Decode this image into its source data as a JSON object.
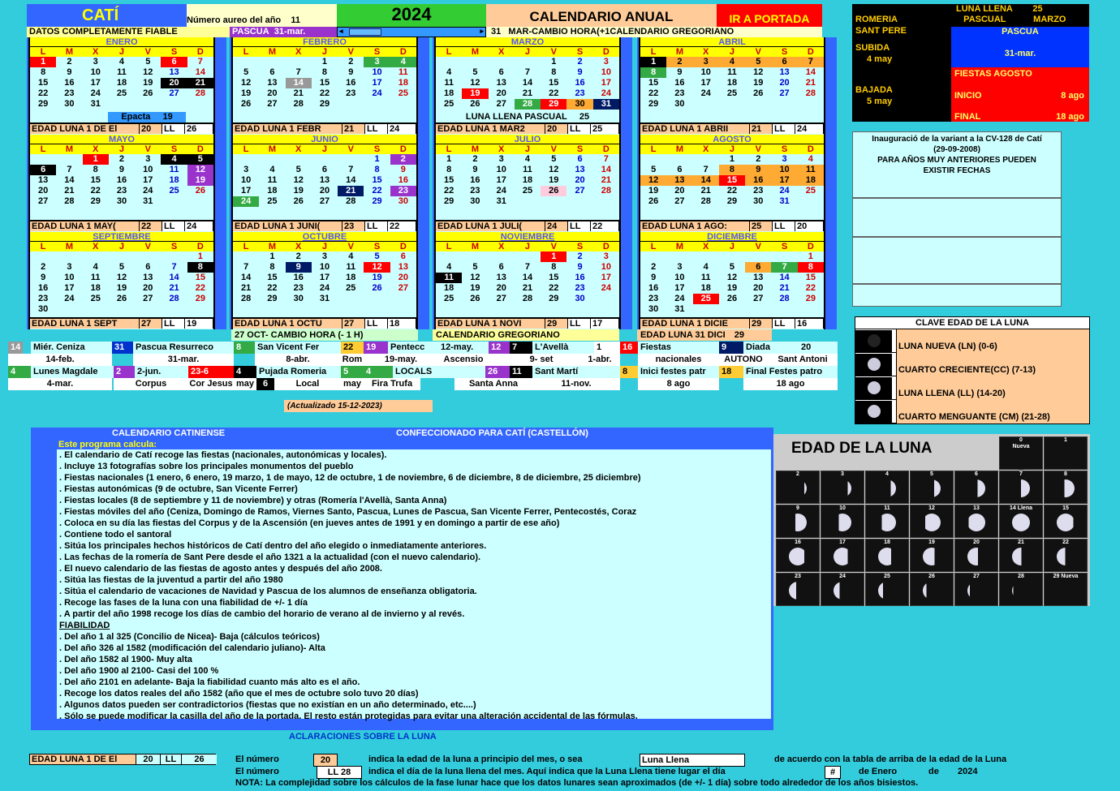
{
  "header": {
    "town": "CATÍ",
    "golden_label": "Número aureo del año",
    "golden_value": "11",
    "year": "2024",
    "title": "CALENDARIO ANUAL",
    "link": "IR A PORTADA",
    "reliable": "DATOS COMPLETAMENTE FIABLE",
    "easter_label": "PASCUA",
    "easter_date": "31-mar.",
    "dst_day": "31",
    "dst_text": "MAR-CAMBIO HORA(+1",
    "greg": "CALENDARIO GREGORIANO"
  },
  "weekdays": [
    "L",
    "M",
    "X",
    "J",
    "V",
    "S",
    "D"
  ],
  "months": [
    {
      "name": "ENERO",
      "offset": 0,
      "days": 31,
      "foot": "EDAD LUNA 1 DE El",
      "age": "20",
      "ll": "LL",
      "lld": "26",
      "extra": "Epacta",
      "extraval": "19",
      "hl": {
        "1": "hl-red",
        "6": "hl-red",
        "20": "hl-black",
        "21": "hl-black"
      }
    },
    {
      "name": "FEBRERO",
      "offset": 3,
      "days": 29,
      "foot": "EDAD LUNA 1 FEBR",
      "age": "21",
      "ll": "LL",
      "lld": "24",
      "hl": {
        "3": "hl-green",
        "4": "hl-green",
        "14": "hl-gray"
      }
    },
    {
      "name": "MARZO",
      "offset": 4,
      "days": 31,
      "foot": "EDAD LUNA 1 MAR2",
      "age": "20",
      "ll": "LL",
      "lld": "25",
      "extra": "LUNA LLENA PASCUAL",
      "extraval": "25",
      "hl": {
        "19": "hl-red",
        "28": "hl-green",
        "29": "hl-red",
        "30": "hl-orange",
        "31": "hl-navy"
      }
    },
    {
      "name": "ABRIL",
      "offset": 0,
      "days": 30,
      "foot": "EDAD LUNA 1 ABRII",
      "age": "21",
      "ll": "LL",
      "lld": "24",
      "hl": {
        "1": "hl-black",
        "2": "hl-orange",
        "3": "hl-orange",
        "4": "hl-orange",
        "5": "hl-orange",
        "6": "hl-orange",
        "7": "hl-orange",
        "8": "hl-green"
      }
    },
    {
      "name": "MAYO",
      "offset": 2,
      "days": 31,
      "foot": "EDAD LUNA 1 MAY(",
      "age": "22",
      "ll": "LL",
      "lld": "24",
      "hl": {
        "1": "hl-red",
        "4": "hl-black",
        "5": "hl-black",
        "6": "hl-black",
        "12": "hl-purple",
        "19": "hl-purple"
      }
    },
    {
      "name": "JUNIO",
      "offset": 5,
      "days": 30,
      "foot": "EDAD LUNA 1 JUNI(",
      "age": "23",
      "ll": "LL",
      "lld": "22",
      "hl": {
        "2": "hl-purple",
        "21": "hl-navy",
        "23": "hl-purple",
        "24": "hl-green"
      }
    },
    {
      "name": "JULIO",
      "offset": 0,
      "days": 31,
      "foot": "EDAD LUNA 1 JULI(",
      "age": "24",
      "ll": "LL",
      "lld": "22",
      "hl": {
        "26": "hl-pink"
      }
    },
    {
      "name": "AGOSTO",
      "offset": 3,
      "days": 31,
      "foot": "EDAD LUNA 1 AGO:",
      "age": "25",
      "ll": "LL",
      "lld": "20",
      "hl": {
        "8": "hl-orange",
        "9": "hl-orange",
        "10": "hl-orange",
        "11": "hl-orange",
        "12": "hl-orange",
        "13": "hl-orange",
        "14": "hl-orange",
        "15": "hl-red",
        "16": "hl-orange",
        "17": "hl-orange",
        "18": "hl-orange"
      }
    },
    {
      "name": "SEPTIEMBRE",
      "offset": 6,
      "days": 30,
      "foot": "EDAD LUNA 1 SEPT",
      "age": "27",
      "ll": "LL",
      "lld": "19",
      "hl": {
        "8": "hl-black"
      }
    },
    {
      "name": "OCTUBRE",
      "offset": 1,
      "days": 31,
      "foot": "EDAD LUNA 1 OCTU",
      "age": "27",
      "ll": "LL",
      "lld": "18",
      "extra": "27  OCT- CAMBIO HORA (- 1 H)",
      "hl": {
        "9": "hl-navy",
        "12": "hl-red"
      }
    },
    {
      "name": "NOVIEMBRE",
      "offset": 4,
      "days": 30,
      "foot": "EDAD LUNA 1 NOVI",
      "age": "29",
      "ll": "LL",
      "lld": "17",
      "extra": "CALENDARIO GREGORIANO",
      "hl": {
        "1": "hl-red",
        "11": "hl-black"
      }
    },
    {
      "name": "DICIEMBRE",
      "offset": 6,
      "days": 31,
      "foot": "EDAD LUNA 1 DICIE",
      "age": "29",
      "ll": "LL",
      "lld": "16",
      "extra": "EDAD LUNA 31 DICI",
      "extraval": "29",
      "hl": {
        "6": "hl-orange",
        "7": "hl-green",
        "8": "hl-red",
        "25": "hl-red"
      }
    }
  ],
  "right": {
    "romeria": "ROMERIA\nSANT PERE",
    "subida": "SUBIDA",
    "subida_val": "4    may",
    "bajada": "BAJADA",
    "bajada_val": "5     may",
    "ll_label": "LUNA LLENA",
    "ll_day": "25",
    "pascual": "PASCUAL",
    "marzo": "MARZO",
    "pascua": "PASCUA",
    "pascua_date": "31-mar.",
    "fiestas": "FIESTAS AGOSTO",
    "inicio": "INICIO",
    "inicio_val": "8  ago",
    "final": "FINAL",
    "final_val": "18  ago",
    "inaug": "Inauguració de la variant a la CV-128 de Catí (29-09-2008)",
    "warn": "PARA AÑOS MUY ANTERIORES PUEDEN EXISTIR FECHAS",
    "clave": "CLAVE EDAD DE LA LUNA",
    "phases": [
      "LUNA NUEVA (LN) (0-6)",
      "CUARTO CRECIENTE(CC) (7-13)",
      "LUNA LLENA (LL) (14-20)",
      "CUARTO MENGUANTE (CM) (21-28)"
    ]
  },
  "legend": [
    [
      "14",
      "Miér. Ceniza",
      "14-feb.",
      "31",
      "Pascua Resurreco",
      "31-mar.",
      "8",
      "San Vicent Fer",
      "8-abr.",
      "Rom",
      "22",
      "19",
      "Pentecc",
      "19-may.",
      "12-may.",
      "12",
      "7",
      "L'Avellà",
      "1",
      "16",
      "Fiestas",
      "nacionales",
      "Ascensio",
      "9- set",
      "1-abr.",
      "9",
      "Diada",
      "20",
      "AUTONO",
      "Sant Antoni"
    ],
    [
      "4",
      "Lunes Magdale",
      "4-mar.",
      "2",
      "2-jun.",
      "Corpus",
      "23-6",
      "Cor Jesus",
      "4",
      "Pujada Romeria",
      "may",
      "6",
      "Local",
      "5",
      "4",
      "Fira Trufa",
      "LOCALS",
      "26",
      "11",
      "Sant Martí",
      "Santa Anna",
      "11-nov.",
      "8",
      "Inici festes patr",
      "8  ago",
      "18",
      "Final Festes patro",
      "18  ago"
    ]
  ],
  "updated": "(Actualizado 15-12-2023)",
  "info": {
    "title": "CALENDARIO CATINENSE",
    "subtitle": "CONFECCIONADO PARA CATÍ (CASTELLÓN)",
    "calc": "Este programa calcula:",
    "lines": [
      ". El calendario de Catí recoge las fiestas (nacionales, autonómicas y locales).",
      ". Incluye 13 fotografías sobre los principales monumentos del pueblo",
      ". Fiestas nacionales (1 enero, 6 enero, 19 marzo, 1 de mayo, 12 de octubre, 1 de noviembre, 6 de diciembre, 8 de diciembre, 25 diciembre)",
      ". Fiestas autonómicas (9 de octubre, San Vicente Ferrer)",
      ". Fiestas locales (8 de septiembre y 11 de noviembre) y otras (Romería l'Avellà, Santa Anna)",
      ". Fiestas móviles del año (Ceniza, Domingo de Ramos, Viernes Santo, Pascua, Lunes de Pascua, San Vicente Ferrer,  Pentecostés, Coraz",
      ". Coloca en su día las fiestas del Corpus y de la Ascensión (en jueves antes de 1991 y en domingo a partir de ese año)",
      ". Contiene todo el santoral",
      ". Sitúa los principales hechos históricos de Catí dentro del año elegido o inmediatamente anteriores.",
      ". Las fechas de la romería de Sant Pere desde el año 1321 a la actualidad (con el nuevo calendario).",
      ". El nuevo calendario de las fiestas de agosto antes y después del año 2008.",
      ". Sitúa las fiestas de la juventud a partir del año 1980",
      ". Sitúa el calendario de vacaciones de Navidad y Pascua de los alumnos de enseñanza obligatoria.",
      ". Recoge las fases de la luna con una fiabilidad de +/- 1 día",
      ".  A partir del año 1998 recoge los días de cambio del horario de verano al de invierno y al revés."
    ],
    "fiab": "FIABILIDAD",
    "fiab_lines": [
      ". Del año 1 al 325 (Concilio de Nicea)-  Baja (cálculos teóricos)",
      ". Del año 326 al 1582 (modificación del calendario juliano)- Alta",
      ". Del año 1582 al 1900- Muy alta",
      ". Del año 1900 al 2100- Casi del 100 %",
      ". Del año 2101 en adelante- Baja la fiabilidad cuanto más alto es el año.",
      ". Recoge los datos reales del año 1582 (año que el mes de octubre solo tuvo 20 días)",
      ". Algunos datos pueden ser contradictorios (fiestas que no existían en un año determinado, etc....)",
      ". Sólo se puede modificar la casilla del año de la portada. El resto están protegidas para evitar una alteración accidental de las fórmulas."
    ]
  },
  "moonpanel": {
    "title": "EDAD DE LA LUNA",
    "labels": [
      "0\nNueva",
      "1",
      "2",
      "3",
      "4",
      "5",
      "6",
      "7",
      "8",
      "9",
      "10",
      "11",
      "12",
      "13",
      "14 Llena",
      "15",
      "16",
      "17",
      "18",
      "19",
      "20",
      "21",
      "22",
      "23",
      "24",
      "25",
      "26",
      "27",
      "28",
      "29 Nueva"
    ]
  },
  "bottom": {
    "aclar": "ACLARACIONES SOBRE LA LUNA",
    "foot": "EDAD LUNA 1 DE El",
    "age": "20",
    "ll": "LL",
    "lld": "26",
    "l1a": "El número",
    "l1v": "20",
    "l1b": "indica la edad de la luna a principio del mes, o sea",
    "l1c": "Luna Llena",
    "l1d": "de acuerdo con la tabla de arriba de la edad de la Luna",
    "l2a": "El número",
    "l2v": "LL   28",
    "l2b": "indica el día de la luna llena del mes. Aquí indica que la Luna Llena tiene lugar el día",
    "l2c": "#",
    "l2d": "de Enero",
    "l2e": "de",
    "l2f": "2024",
    "l3": "NOTA: La complejidad sobre los cálculos de la fase lunar hace que los datos lunares sean aproximados (de +/- 1 día) sobre todo alrededor de los años bisiestos."
  }
}
